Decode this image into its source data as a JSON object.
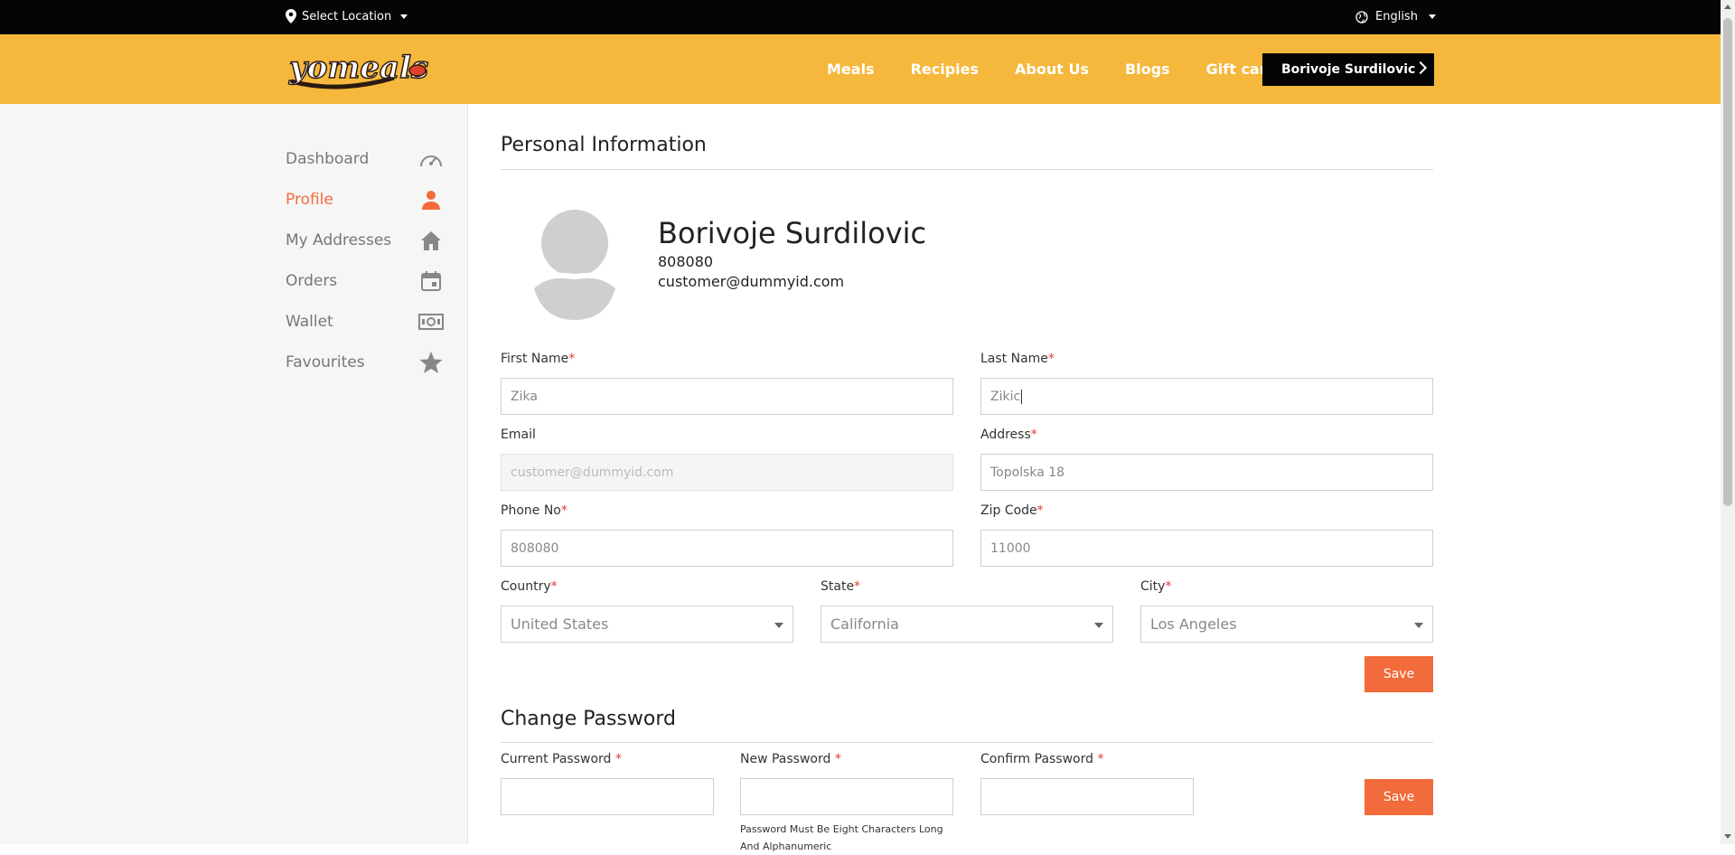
{
  "topbar": {
    "location_label": "Select Location",
    "language_label": "English"
  },
  "header": {
    "logo_text": "yomeals",
    "nav": [
      "Meals",
      "Recipies",
      "About Us",
      "Blogs",
      "Gift card"
    ],
    "user_button": "Borivoje Surdilovic"
  },
  "sidebar": {
    "items": [
      {
        "label": "Dashboard",
        "icon": "speedometer-icon"
      },
      {
        "label": "Profile",
        "icon": "person-icon",
        "active": true
      },
      {
        "label": "My Addresses",
        "icon": "home-icon"
      },
      {
        "label": "Orders",
        "icon": "calendar-icon"
      },
      {
        "label": "Wallet",
        "icon": "money-icon"
      },
      {
        "label": "Favourites",
        "icon": "star-icon"
      }
    ]
  },
  "personal": {
    "title": "Personal Information",
    "profile_name": "Borivoje Surdilovic",
    "profile_phone": "808080",
    "profile_email": "customer@dummyid.com",
    "first_name": {
      "label": "First Name",
      "value": "Zika"
    },
    "last_name": {
      "label": "Last Name",
      "value": "Zikic"
    },
    "email": {
      "label": "Email",
      "value": "customer@dummyid.com"
    },
    "address": {
      "label": "Address",
      "value": "Topolska 18"
    },
    "phone": {
      "label": "Phone No",
      "value": "808080"
    },
    "zip": {
      "label": "Zip Code",
      "value": "11000"
    },
    "country": {
      "label": "Country",
      "value": "United States"
    },
    "state": {
      "label": "State",
      "value": "California"
    },
    "city": {
      "label": "City",
      "value": "Los Angeles"
    },
    "save_label": "Save"
  },
  "password": {
    "title": "Change Password",
    "current_label": "Current Password",
    "new_label": "New Password",
    "confirm_label": "Confirm Password",
    "hint": "Password Must Be Eight Characters Long And Alphanumeric",
    "save_label": "Save"
  },
  "colors": {
    "accent": "#f26b3a",
    "header": "#f5b83d",
    "topbar": "#050505"
  }
}
